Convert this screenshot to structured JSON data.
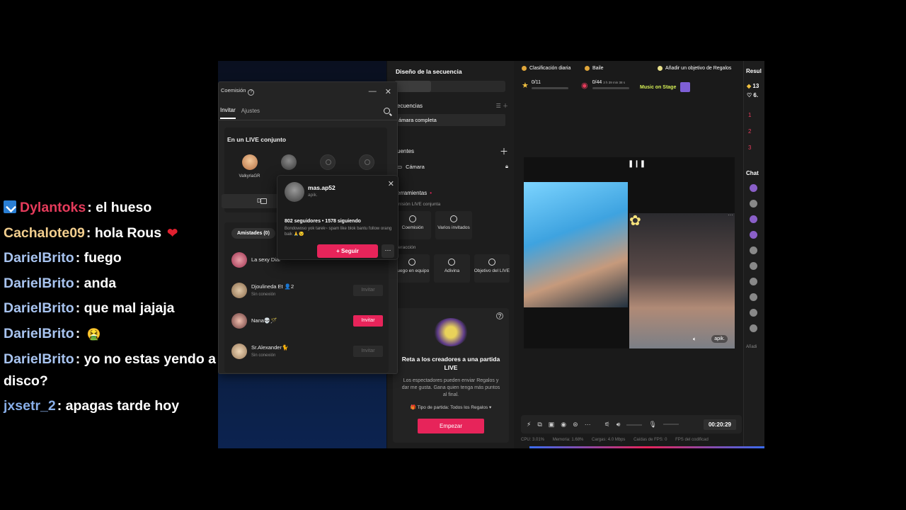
{
  "chat": [
    {
      "user": "Dylantoks",
      "color": "#e53b5b",
      "badge": true,
      "message": "el hueso"
    },
    {
      "user": "Cachalote09",
      "color": "#f2ce8e",
      "message": "hola Rous",
      "heart": "❤"
    },
    {
      "user": "DarielBrito",
      "color": "#a8c4f0",
      "message": "fuego"
    },
    {
      "user": "DarielBrito",
      "color": "#a8c4f0",
      "message": "anda"
    },
    {
      "user": "DarielBrito",
      "color": "#a8c4f0",
      "message": "que mal jajaja"
    },
    {
      "user": "DarielBrito",
      "color": "#a8c4f0",
      "message": "",
      "emoji": "🤮"
    },
    {
      "user": "DarielBrito",
      "color": "#a8c4f0",
      "message": "yo no estas yendo a disco?"
    },
    {
      "user": "jxsetr_2",
      "color": "#88aee8",
      "message": "apagas tarde hoy"
    }
  ],
  "panel": {
    "title": "Coemisión",
    "help": "?",
    "minimize": "—",
    "close": "✕",
    "tabs": [
      "Invitar",
      "Ajustes"
    ],
    "live_title": "En un LIVE conjunto",
    "slot1_name": "ValkyriaGR",
    "share_label": "D",
    "friends_label": "Amistades (0)",
    "friends": [
      {
        "name": "La sexy Dial",
        "status": "",
        "invite": ""
      },
      {
        "name": "Djoulineda Et 👤2",
        "status": "Sin conexión",
        "invite": "Invitar"
      },
      {
        "name": "Nana💀🪄",
        "status": "",
        "invite": "Invitar"
      },
      {
        "name": "Sr.Alexander🐈",
        "status": "Sin conexión",
        "invite": "Invitar"
      }
    ]
  },
  "popup": {
    "name": "mas.ap52",
    "handle": "apik.",
    "close": "✕",
    "stats": "802 seguidores  •  1578 siguiendo",
    "bio": "Bondowoso yok tarek~ spam like blok bantu follow orang baik 🙏😉",
    "follow": "+ Seguir",
    "more": "···"
  },
  "mid": {
    "title": "Diseño de la secuencia",
    "seq_label": "ecuencias",
    "seq_item": "ámara completa",
    "src_label": "uentes",
    "camera": "Cámara",
    "tools_label": "erramientas",
    "cohost_label": "misión LIVE conjunta",
    "tool_cohost": "Coemisión",
    "tool_guests": "Varios invitados",
    "interaction_label": "teracción",
    "tool_game": "Juego en equipo",
    "tool_guess": "Adivina",
    "tool_goal": "Objetivo del LIVE",
    "card_title": "Reta a los creadores a una partida LIVE",
    "card_desc": "Los espectadores pueden enviar Regalos y dar me gusta. Gana quien tenga más puntos al final.",
    "card_type": "🎁 Tipo de partida: Todos los Regalos ▾",
    "start": "Empezar"
  },
  "main": {
    "daily_rank": "Clasificación diaria",
    "dance": "Baile",
    "add_goal": "Añadir un objetivo de Regalos",
    "stars": "0/11",
    "gifts": "0/44",
    "gift_time": "3 h 39 min 38 s",
    "music_on_stage": "Music on Stage",
    "handle": "apik.",
    "timer": "00:20:29",
    "status": {
      "cpu": "CPU: 3.01%",
      "memory": "Memoria: 1.68%",
      "load": "Cargas: 4.0 Mbps",
      "fps_drops": "Caídas de FPS: 0",
      "fps_codec": "FPS del codificad"
    }
  },
  "right": {
    "results": "Resul",
    "count1": "13",
    "count2": "6.",
    "chat": "Chat",
    "add": "Añadi"
  },
  "colors": {
    "accent": "#e7245a",
    "music": "#d6f056"
  }
}
